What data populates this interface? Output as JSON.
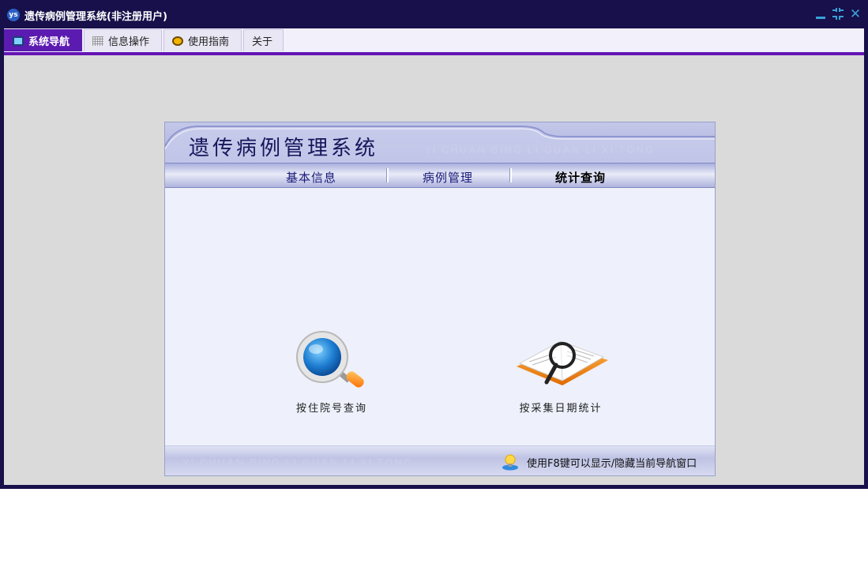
{
  "window": {
    "title": "遗传病例管理系统(非注册用户)",
    "app_icon_text": "ys",
    "controls": {
      "minimize": "minimize-icon",
      "restore": "restore-icon",
      "close": "close-icon"
    }
  },
  "tabs": [
    {
      "label": "系统导航",
      "icon": "monitor-icon",
      "active": true
    },
    {
      "label": "信息操作",
      "icon": "grid-icon",
      "active": false
    },
    {
      "label": "使用指南",
      "icon": "lightbulb-icon",
      "active": false
    },
    {
      "label": "关于",
      "icon": "",
      "active": false
    }
  ],
  "panel": {
    "title": "遗传病例管理系统",
    "subtitle": "YI CHUAN BING LI GUAN LI XI TONG",
    "nav": [
      {
        "label": "基本信息",
        "active": false
      },
      {
        "label": "病例管理",
        "active": false
      },
      {
        "label": "统计查询",
        "active": true
      }
    ],
    "features": [
      {
        "label": "按住院号查询",
        "icon": "magnifier-icon"
      },
      {
        "label": "按采集日期统计",
        "icon": "book-magnifier-icon"
      }
    ],
    "footer": {
      "subtitle": "YI CHUAN BING LI GUAN LI XI TONG",
      "hint": "使用F8键可以显示/隐藏当前导航窗口",
      "hint_icon": "info-lightbulb-icon"
    }
  },
  "colors": {
    "title_bg": "#17104a",
    "tab_active_bg": "#5b1bb0",
    "tab_underline": "#6414b4",
    "client_bg": "#dadada",
    "panel_bg": "#eef0fb",
    "control_blue": "#3aa0d8"
  }
}
